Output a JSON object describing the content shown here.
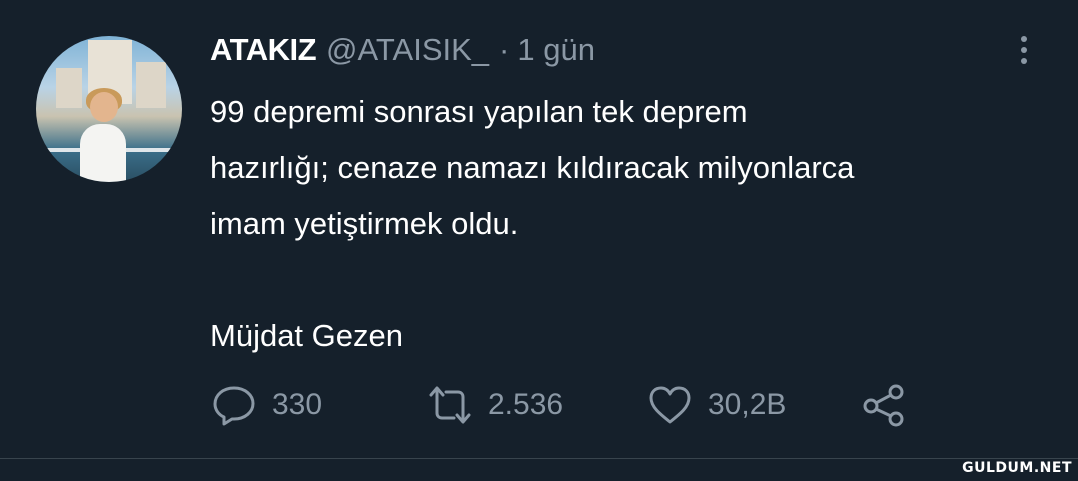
{
  "user": {
    "display_name": "ATAKIZ",
    "handle": "@ATAISIK_",
    "separator": "·",
    "time": "1 gün"
  },
  "tweet": {
    "lines": [
      "99 depremi sonrası yapılan tek deprem",
      "hazırlığı; cenaze namazı kıldıracak milyonlarca",
      "imam yetiştirmek oldu."
    ],
    "signature": "Müjdat Gezen"
  },
  "actions": {
    "reply_icon": "reply-icon",
    "replies": "330",
    "retweet_icon": "retweet-icon",
    "retweets": "2.536",
    "like_icon": "heart-icon",
    "likes": "30,2B",
    "share_icon": "share-icon"
  },
  "watermark": "GULDUM.NET",
  "colors": {
    "background": "#15202b",
    "text": "#ffffff",
    "secondary": "#8b98a5"
  }
}
